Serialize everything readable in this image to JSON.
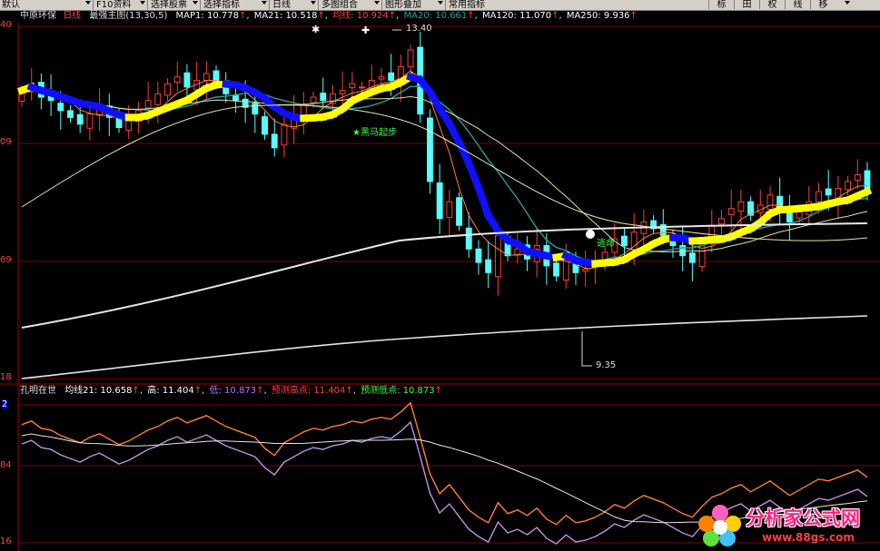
{
  "toolbar": {
    "items": [
      {
        "label": "默认"
      },
      {
        "label": "F10资料"
      },
      {
        "label": "选择股票"
      },
      {
        "label": "选择指标"
      },
      {
        "label": "日线"
      },
      {
        "label": "多图组合"
      },
      {
        "label": "图形叠加"
      },
      {
        "label": "常用指标"
      }
    ],
    "right_buttons": [
      "标",
      "田",
      "权",
      "线",
      "移"
    ]
  },
  "main_info": {
    "stock_name": "中原环保",
    "period": "日线",
    "indicator": "最强主图(13,30,5)",
    "map1": "MAP1: 10.778",
    "ma21": "MA21: 10.518",
    "junxian": "均线: 10.924",
    "ma20": "MA20: 10.661",
    "ma120": "MA120: 11.070",
    "ma250": "MA250: 9.936",
    "up_arrow": "↑"
  },
  "price_axis": [
    "40",
    "09",
    "69",
    "18"
  ],
  "annotations": {
    "high_label": "13.40",
    "low_label": "9.35",
    "signal_buy": "★黑马起步",
    "signal_escape": "逃命"
  },
  "sub_info": {
    "name": "孔明在世",
    "junxian21": "均线21: 10.658",
    "gao": "高: 11.404",
    "di": "低: 10.873",
    "yuce_gao": "预测高点: 11.404",
    "yuce_di": "预测低点: 10.873",
    "up_arrow": "↑"
  },
  "sub_axis": [
    "2",
    "84",
    "16"
  ],
  "watermark": {
    "name": "分析家公式网",
    "url": "www.88gs.com"
  },
  "colors": {
    "up_candle": "#ff3c3c",
    "down_candle": "#54ffff",
    "yellow": "#ffff00",
    "blue": "#1010ff",
    "teal": "#20a0a0",
    "grid_red": "#800000"
  }
}
